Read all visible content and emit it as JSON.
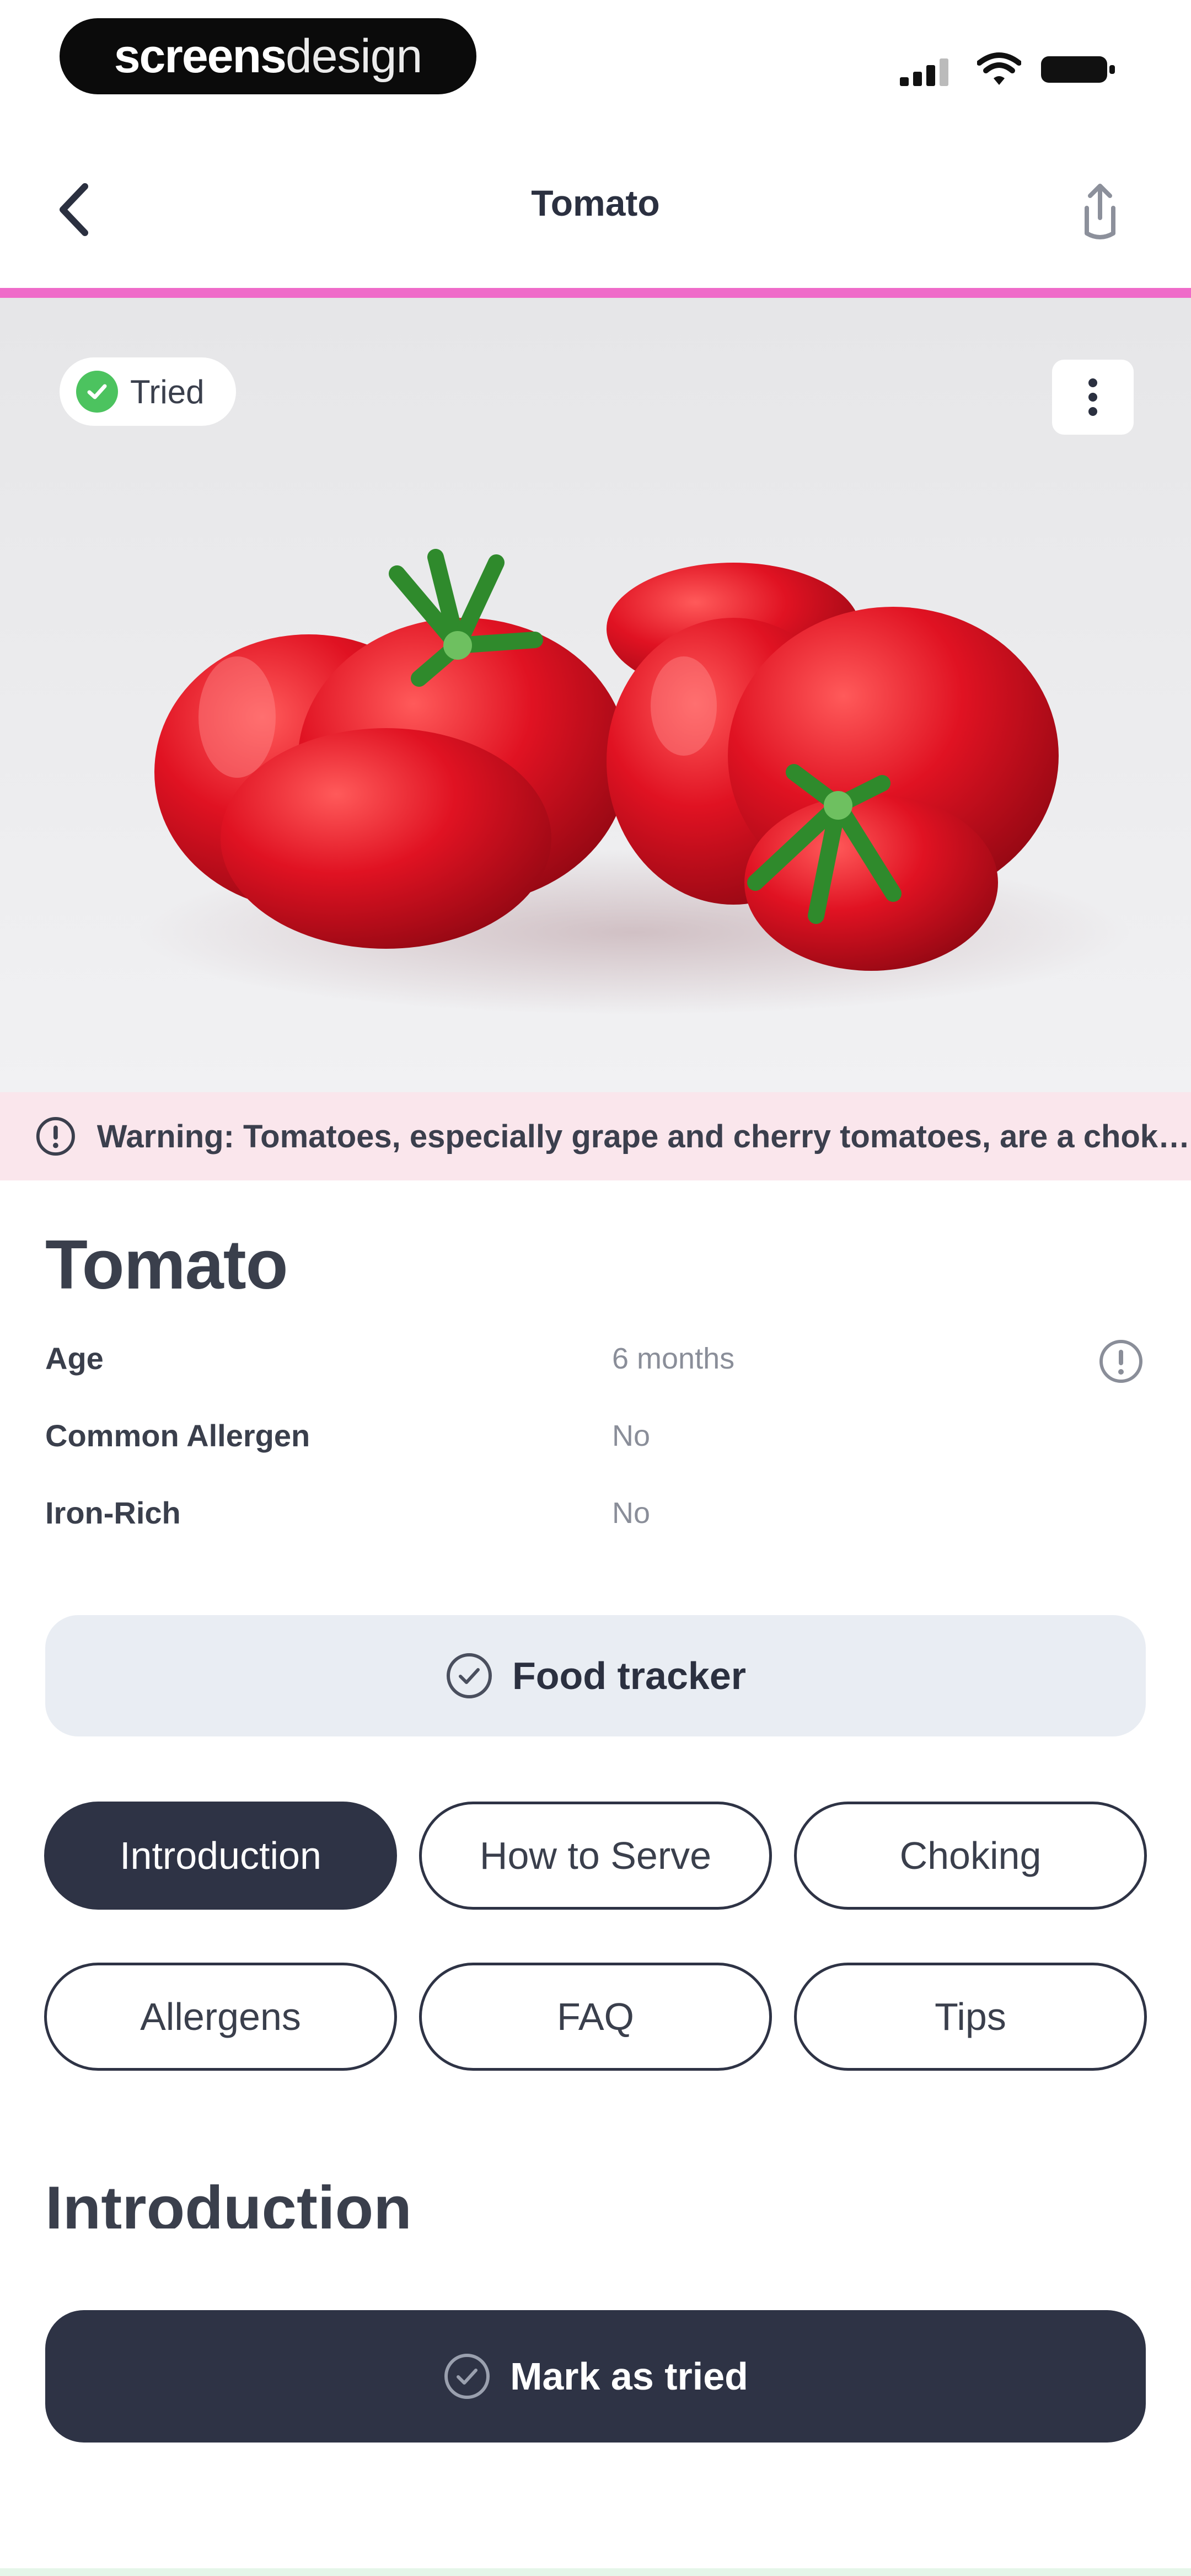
{
  "status_bar": {
    "brand_part1": "screens",
    "brand_part2": "design"
  },
  "nav": {
    "title": "Tomato",
    "back_icon": "chevron-left-icon",
    "share_icon": "share-icon"
  },
  "hero": {
    "tried_label": "Tried",
    "tried_icon": "check-circle-icon",
    "more_icon": "vertical-dots-icon"
  },
  "warning": {
    "icon": "info-icon",
    "text": "Warning: Tomatoes, especially grape and cherry tomatoes, are a choking hazard"
  },
  "details": {
    "name": "Tomato",
    "rows": [
      {
        "label": "Age",
        "value": "6 months"
      },
      {
        "label": "Common Allergen",
        "value": "No"
      },
      {
        "label": "Iron-Rich",
        "value": "No"
      }
    ]
  },
  "food_tracker": {
    "label": "Food tracker",
    "icon": "check-circle-icon"
  },
  "tabs": [
    {
      "label": "Introduction",
      "active": true
    },
    {
      "label": "How to Serve",
      "active": false
    },
    {
      "label": "Choking",
      "active": false
    },
    {
      "label": "Allergens",
      "active": false
    },
    {
      "label": "FAQ",
      "active": false
    },
    {
      "label": "Tips",
      "active": false
    }
  ],
  "section": {
    "title": "Introduction"
  },
  "cta": {
    "label": "Mark as tried",
    "icon": "check-circle-icon"
  },
  "colors": {
    "accent_pink": "#ef6bc9",
    "navy": "#2e3345",
    "tried_green": "#4cc35f",
    "warning_bg": "#fae6ec",
    "tracker_bg": "#e9edf3"
  }
}
